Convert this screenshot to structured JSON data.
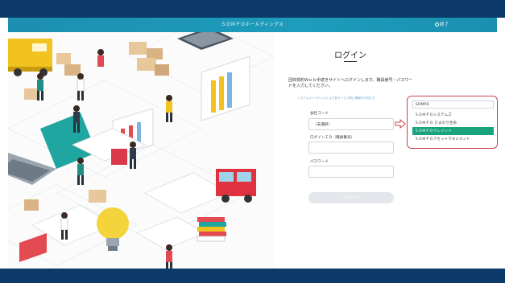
{
  "header": {
    "title": "ＳＯＭＰＯホールディングス",
    "logout_label": "終了"
  },
  "login": {
    "title": "ログイン",
    "description": "団体契約Ｗｅｂ手続きサイトへログインします。職員番号・パスワードを入力してください。",
    "notice": "システムメンテナンスにより各サービス停止情報をお知らせ",
    "company_code_label": "会社コード",
    "company_code_value": "（未選択）",
    "employee_id_label": "ログインＩＤ（職員番号）",
    "employee_id_value": "",
    "password_label": "パスワード",
    "password_value": "",
    "login_button": "ログイン"
  },
  "company_dropdown": {
    "selected": "SOMPO",
    "options": [
      "ＳＯＭＰＯシステムズ",
      "ＳＯＭＰＯ ひまわり生命",
      "ＳＯＭＰＯクレジット",
      "ＳＯＭＰＯアセットマネジメント"
    ],
    "highlighted_index": 2
  },
  "colors": {
    "header": "#1e9cbb",
    "highlight": "#18a37d",
    "callout": "#c9424a",
    "frame": "#0c3a6b"
  }
}
